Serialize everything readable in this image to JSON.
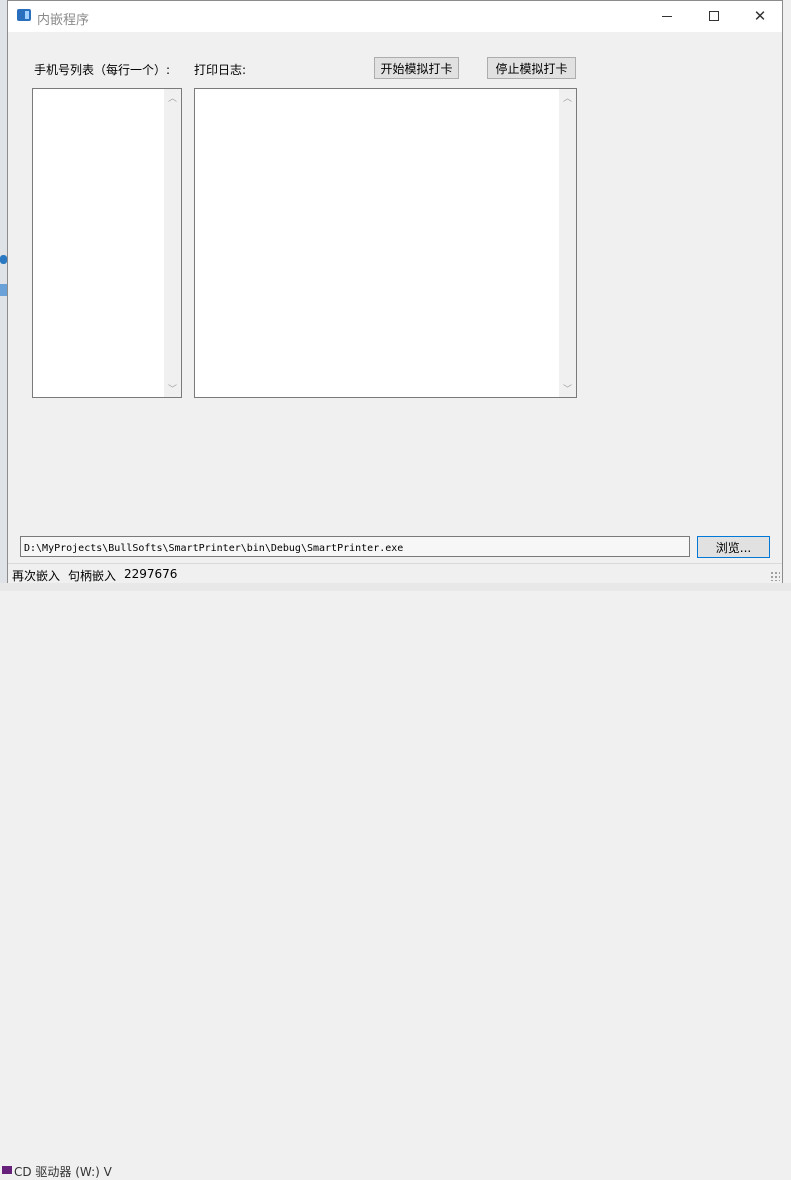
{
  "window": {
    "title": "内嵌程序"
  },
  "labels": {
    "phone_list": "手机号列表（每行一个）:",
    "print_log": "打印日志:"
  },
  "buttons": {
    "start": "开始模拟打卡",
    "stop": "停止模拟打卡",
    "browse": "浏览..."
  },
  "path_input": {
    "value": "D:\\MyProjects\\BullSofts\\SmartPrinter\\bin\\Debug\\SmartPrinter.exe"
  },
  "status": {
    "item1": "再次嵌入",
    "item2": "句柄嵌入",
    "item3": "2297676"
  },
  "taskbar": {
    "text": "CD 驱动器 (W:) V"
  },
  "icons": {
    "app": "app-window-icon",
    "minimize": "minimize-icon",
    "maximize": "maximize-icon",
    "close": "close-icon"
  }
}
